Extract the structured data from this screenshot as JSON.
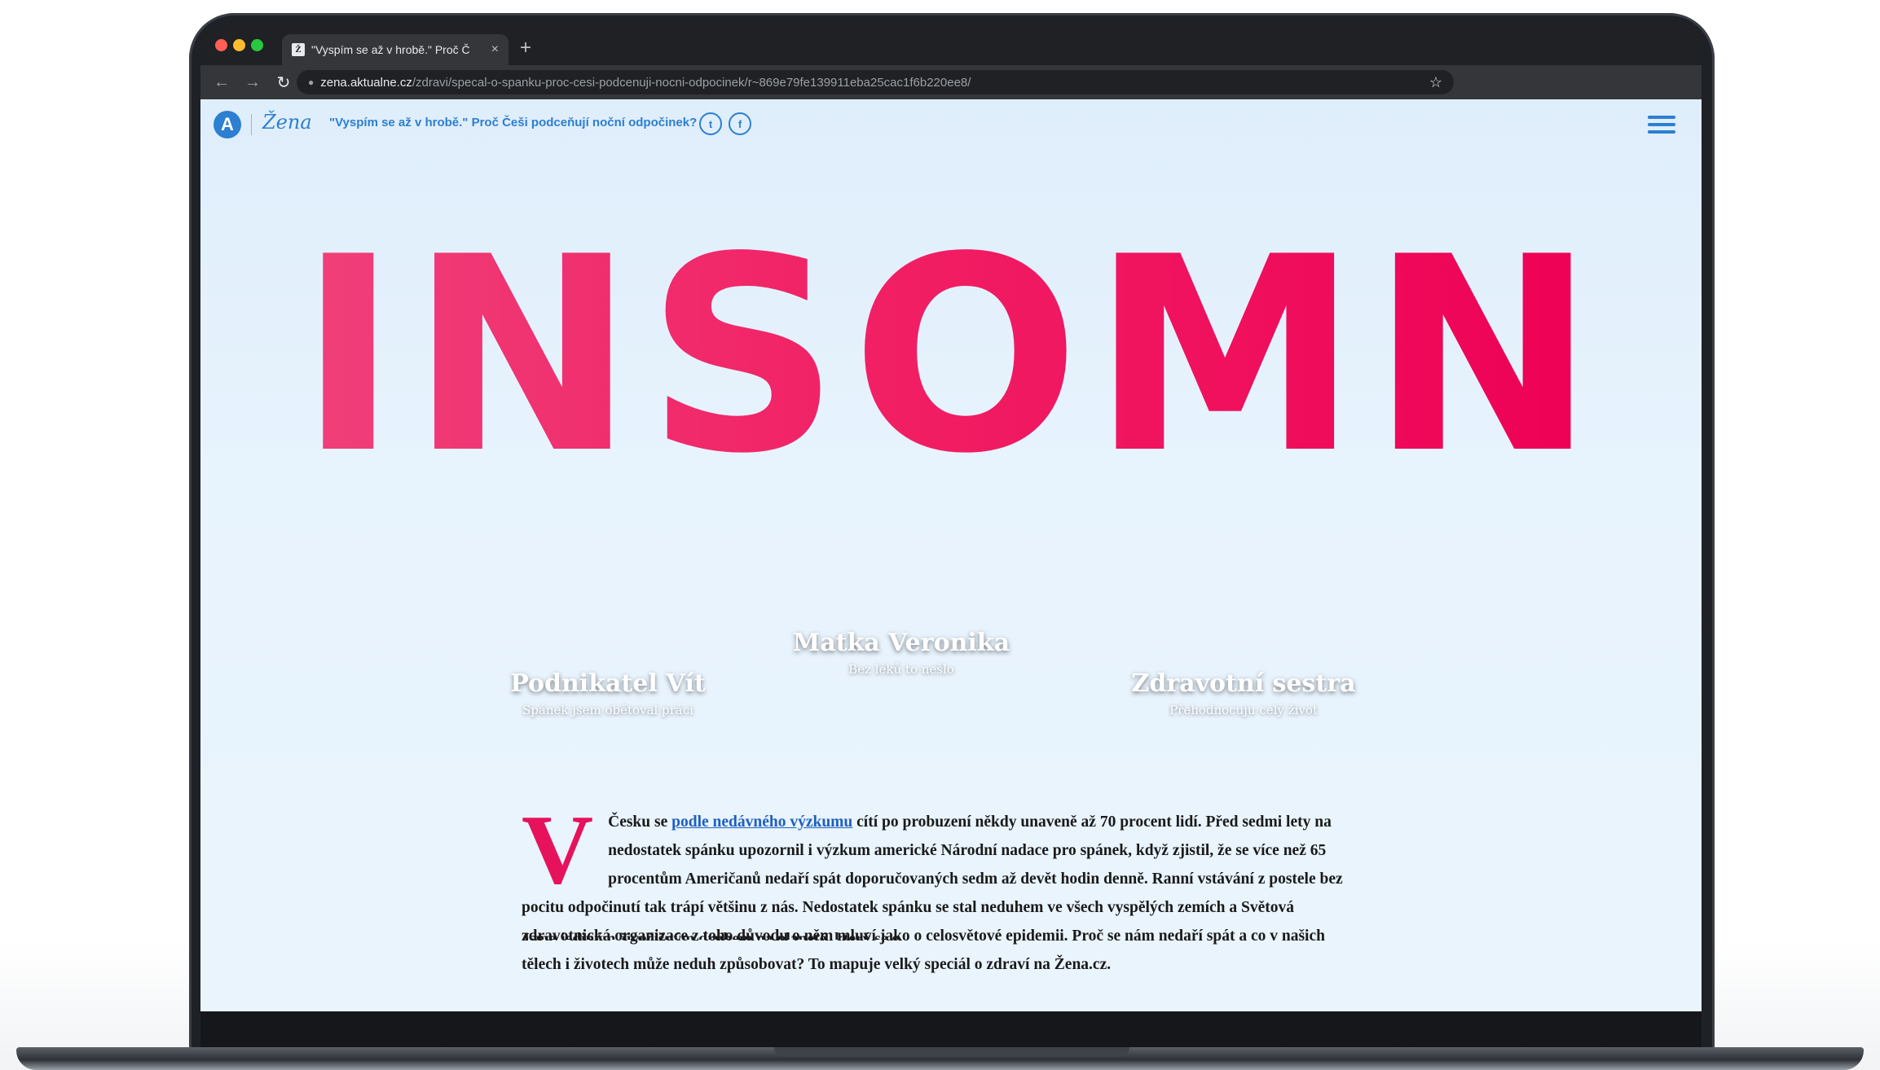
{
  "browser": {
    "tab_title": "\"Vyspím se až v hrobě.\" Proč Č",
    "tab_favicon": "Ž",
    "tab_close": "×",
    "new_tab": "+",
    "url_domain": "zena.aktualne.cz",
    "url_path": "/zdravi/specal-o-spanku-proc-cesi-podcenuji-nocni-odpocinek/r~869e79fe139911eba25cac1f6b220ee8/",
    "nav_icons": {
      "back": "←",
      "forward": "→",
      "reload": "↻"
    },
    "star": "☆",
    "lock": "🔒"
  },
  "header": {
    "logo_a": "A",
    "logo_zena": "Žena",
    "title": "\"Vyspím se až v hrobě.\" Proč Češi podceňují noční odpočinek?",
    "twitter_icon": "t",
    "facebook_icon": "f"
  },
  "hero": {
    "word": "INSOMNIE",
    "people": [
      {
        "name": "Podnikatel Vít",
        "subtitle": "Spánek jsem obětoval práci"
      },
      {
        "name": "Matka Veronika",
        "subtitle": "Bez léků to nešlo"
      },
      {
        "name": "Zdravotní sestra",
        "subtitle": "Přehodnocuju celý život"
      }
    ]
  },
  "article": {
    "dropcap": "V",
    "intro_start": " Česku se ",
    "link_text": "podle nedávného výzkumu",
    "intro_rest": " cítí po probuzení někdy unaveně až 70 procent lidí. Před sedmi lety na nedostatek spánku upozornil i výzkum americké Národní nadace pro spánek, když zjistil, že se více než 65 procentům Američanů nedaří spát doporučovaných sedm až devět hodin denně. Ranní vstávání z postele bez pocitu odpočinutí tak trápí většinu z nás. Nedostatek spánku se stal neduhem ve všech vyspělých zemích a Světová zdravotnická organizace z toho důvodu o něm mluví jako o celosvětové epidemii. Proč se nám nedaří spát a co v našich tělech i životech může neduh způsobovat? To mapuje velký speciál o zdraví na Žena.cz.",
    "next_paragraph": "Jsme jediným živočišným druhem na planetě, který se o..."
  },
  "colors": {
    "accent_pink": "#ee0055",
    "brand_blue": "#2c7fd1",
    "page_bg": "#e3f1fc"
  }
}
